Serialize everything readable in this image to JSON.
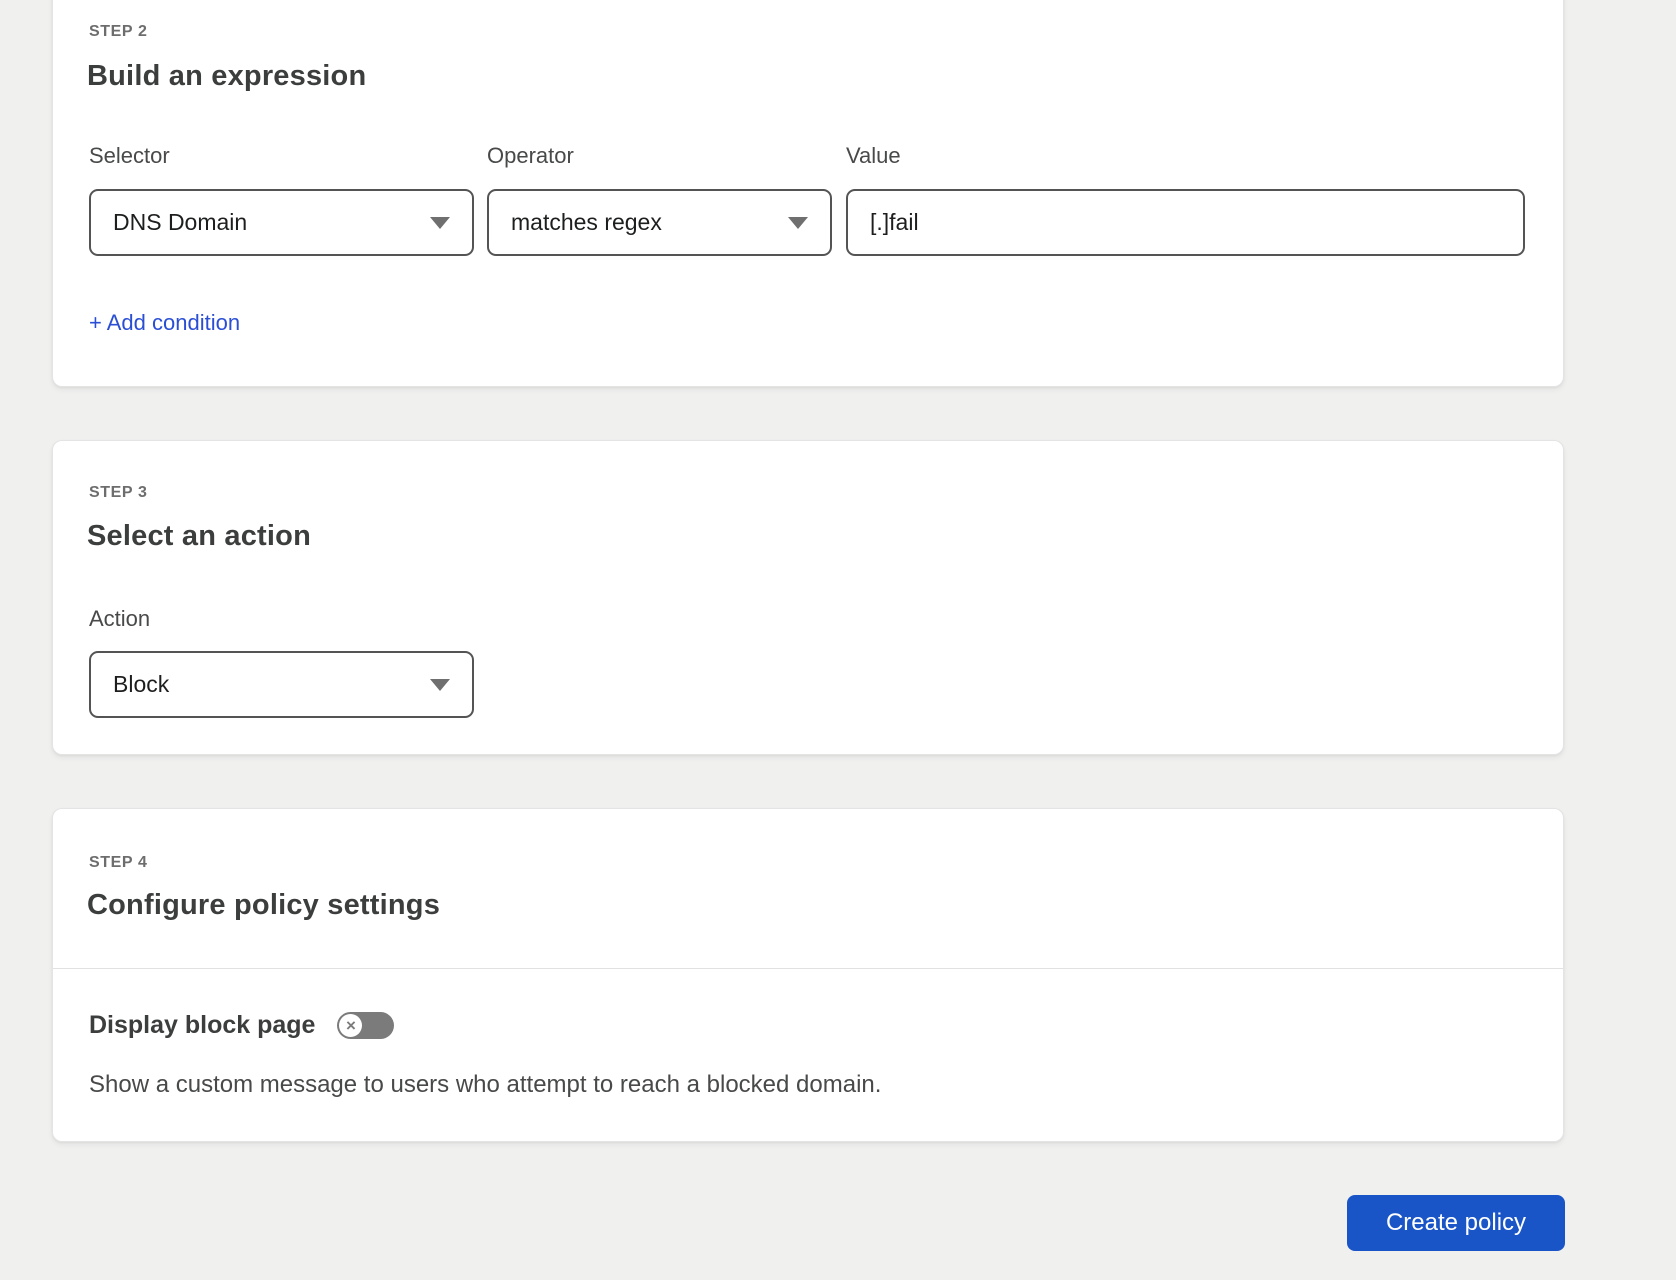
{
  "colors": {
    "bg": "#f0f0ef",
    "link-blue": "#2b4fd4",
    "button-blue": "#1a55c8",
    "toggle-track": "#7b7b7b",
    "control-border": "#545454"
  },
  "step2": {
    "step_label": "STEP 2",
    "title": "Build an expression",
    "selector": {
      "label": "Selector",
      "value": "DNS Domain"
    },
    "operator": {
      "label": "Operator",
      "value": "matches regex"
    },
    "value": {
      "label": "Value",
      "value": "[.]fail"
    },
    "add_condition_label": "+ Add condition"
  },
  "step3": {
    "step_label": "STEP 3",
    "title": "Select an action",
    "action": {
      "label": "Action",
      "value": "Block"
    }
  },
  "step4": {
    "step_label": "STEP 4",
    "title": "Configure policy settings",
    "display_block_page": {
      "label": "Display block page",
      "toggle_state": "off",
      "toggle_icon": "×",
      "description": "Show a custom message to users who attempt to reach a blocked domain."
    }
  },
  "footer": {
    "create_policy_label": "Create policy"
  }
}
